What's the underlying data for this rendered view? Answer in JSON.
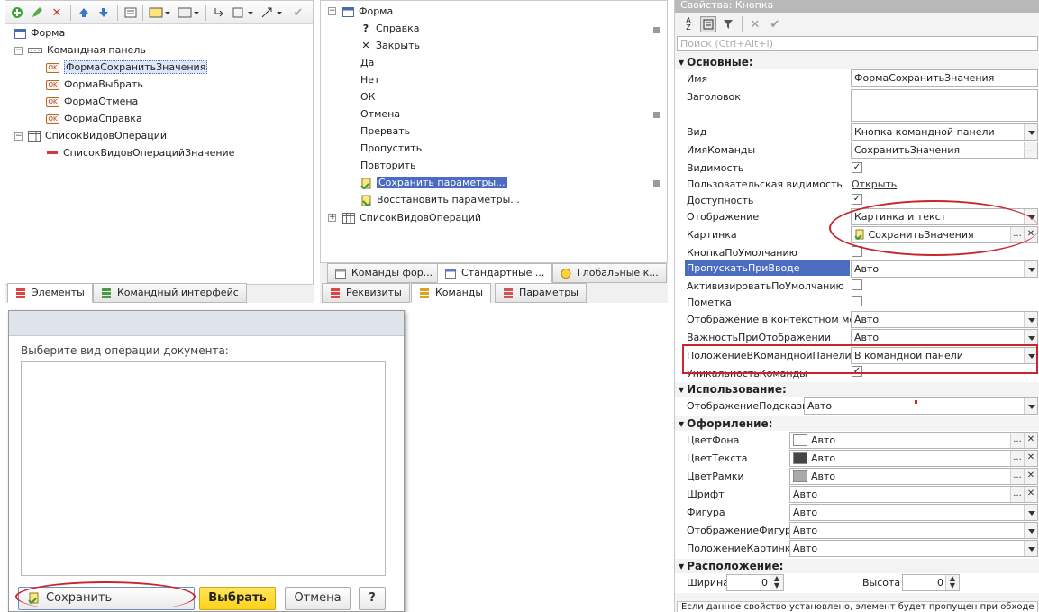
{
  "elements_tree": {
    "root": "Форма",
    "command_panel": "Командная панель",
    "commands": [
      "ФормаСохранитьЗначения",
      "ФормаВыбрать",
      "ФормаОтмена",
      "ФормаСправка"
    ],
    "list": "СписокВидовОпераций",
    "list_value": "СписокВидовОперацийЗначение"
  },
  "left_tabs": [
    "Элементы",
    "Командный интерфейс"
  ],
  "commands_tree": {
    "root": "Форма",
    "items": [
      "Справка",
      "Закрыть",
      "Да",
      "Нет",
      "ОК",
      "Отмена",
      "Прервать",
      "Пропустить",
      "Повторить",
      "Сохранить параметры...",
      "Восстановить параметры..."
    ],
    "list": "СписокВидовОпераций"
  },
  "middle_tabs_top": [
    "Команды фор...",
    "Стандартные ...",
    "Глобальные к..."
  ],
  "middle_tabs_bottom": [
    "Реквизиты",
    "Команды",
    "Параметры"
  ],
  "preview": {
    "label": "Выберите вид операции документа:",
    "btn_save": "Сохранить параметры...",
    "btn_select": "Выбрать",
    "btn_cancel": "Отмена",
    "btn_help": "?"
  },
  "props": {
    "title": "Свойства: Кнопка",
    "search_placeholder": "Поиск (Ctrl+Alt+I)",
    "sec_main": "Основные:",
    "l_name": "Имя",
    "v_name": "ФормаСохранитьЗначения",
    "l_header": "Заголовок",
    "l_type": "Вид",
    "v_type": "Кнопка командной панели",
    "l_cmd": "ИмяКоманды",
    "v_cmd": "СохранитьЗначения",
    "l_visible": "Видимость",
    "l_uservis": "Пользовательская видимость",
    "v_uservis": "Открыть",
    "l_enabled": "Доступность",
    "l_display": "Отображение",
    "v_display": "Картинка и текст",
    "l_picture": "Картинка",
    "v_picture": "СохранитьЗначения",
    "l_default": "КнопкаПоУмолчанию",
    "l_skip": "ПропускатьПриВводе",
    "v_skip": "Авто",
    "l_activate": "АктивизироватьПоУмолчанию",
    "l_mark": "Пометка",
    "l_ctxmenu": "Отображение в контекстном меню",
    "v_ctxmenu": "Авто",
    "l_importance": "ВажностьПриОтображении",
    "v_importance": "Авто",
    "l_position": "ПоложениеВКоманднойПанели",
    "v_position": "В командной панели",
    "l_unique": "УникальностьКоманды",
    "sec_use": "Использование:",
    "l_tooltip": "ОтображениеПодсказки",
    "v_tooltip": "Авто",
    "sec_design": "Оформление:",
    "l_bg": "ЦветФона",
    "v_bg": "Авто",
    "l_fg": "ЦветТекста",
    "v_fg": "Авто",
    "l_border": "ЦветРамки",
    "v_border": "Авто",
    "l_font": "Шрифт",
    "v_font": "Авто",
    "l_shape": "Фигура",
    "v_shape": "Авто",
    "l_shapedisp": "ОтображениеФигуры",
    "v_shapedisp": "Авто",
    "l_picpos": "ПоложениеКартинки",
    "v_picpos": "Авто",
    "sec_layout": "Расположение:",
    "l_width": "Ширина",
    "v_width": "0",
    "l_height": "Высота",
    "v_height": "0",
    "hint": "Если данное свойство установлено, элемент будет пропущен при обходе"
  },
  "colors": {
    "selection": "#4b6cc1",
    "highlight": "#c8252d",
    "accent_yellow": "#ffd92e"
  }
}
